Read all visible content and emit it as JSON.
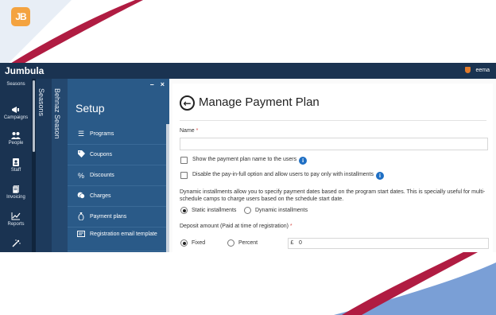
{
  "branding": {
    "logo_text": "JB",
    "app_name": "Jumbula",
    "accent_orange": "#f4a340",
    "nav_dark": "#1a3351"
  },
  "user": {
    "name": "eema"
  },
  "nav": {
    "items": [
      {
        "label": "Seasons",
        "icon": "calendar-icon"
      },
      {
        "label": "Campaigns",
        "icon": "megaphone-icon"
      },
      {
        "label": "People",
        "icon": "people-icon"
      },
      {
        "label": "Staff",
        "icon": "id-badge-icon"
      },
      {
        "label": "Invoicing",
        "icon": "invoice-icon"
      },
      {
        "label": "Reports",
        "icon": "chart-icon"
      }
    ]
  },
  "columns": {
    "seasons_title": "Seasons",
    "season_name": "Behnaz Season"
  },
  "setup": {
    "title": "Setup",
    "controls": {
      "minimize": "–",
      "close": "×"
    },
    "items": [
      {
        "label": "Programs",
        "icon": "list-icon"
      },
      {
        "label": "Coupons",
        "icon": "tag-icon"
      },
      {
        "label": "Discounts",
        "icon": "percent-icon"
      },
      {
        "label": "Charges",
        "icon": "coins-icon"
      },
      {
        "label": "Payment plans",
        "icon": "money-bag-icon"
      },
      {
        "label": "Registration email template",
        "icon": "email-template-icon"
      }
    ]
  },
  "form": {
    "title": "Manage Payment Plan",
    "name_label": "Name",
    "required_mark": "*",
    "name_value": "",
    "show_name_label": "Show the payment plan name to the users",
    "disable_payinfull_label": "Disable the pay-in-full option and allow users to pay only with installments",
    "dynamic_help": "Dynamic installments allow you to specify payment dates based on the program start dates. This is specially useful for multi-schedule camps to charge users based on the schedule start date.",
    "installment_options": [
      {
        "label": "Static installments",
        "selected": true
      },
      {
        "label": "Dynamic installments",
        "selected": false
      }
    ],
    "deposit_label": "Deposit amount (Paid at time of registration)",
    "deposit_types": [
      {
        "label": "Fixed",
        "selected": true
      },
      {
        "label": "Percent",
        "selected": false
      }
    ],
    "currency": "£",
    "deposit_value": "0"
  }
}
